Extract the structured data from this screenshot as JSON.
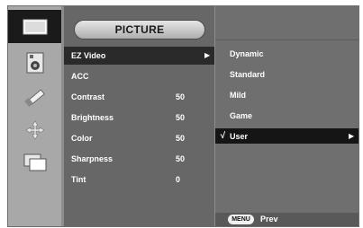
{
  "menu": {
    "title": "PICTURE",
    "items": [
      {
        "label": "EZ Video",
        "value": "",
        "arrow": "▶"
      },
      {
        "label": "ACC",
        "value": ""
      },
      {
        "label": "Contrast",
        "value": "50"
      },
      {
        "label": "Brightness",
        "value": "50"
      },
      {
        "label": "Color",
        "value": "50"
      },
      {
        "label": "Sharpness",
        "value": "50"
      },
      {
        "label": "Tint",
        "value": "0"
      }
    ]
  },
  "submenu": {
    "options": [
      {
        "label": "Dynamic"
      },
      {
        "label": "Standard"
      },
      {
        "label": "Mild"
      },
      {
        "label": "Game"
      },
      {
        "label": "User",
        "check": "√",
        "arrow": "▶"
      }
    ],
    "footer": {
      "button": "MENU",
      "label": "Prev"
    }
  },
  "icons": [
    "picture-icon",
    "audio-icon",
    "settings-icon",
    "position-icon",
    "pip-icon"
  ],
  "colors": {
    "frame": "#8d8d8d",
    "main_panel": "#676767",
    "sub_panel": "#6f6f6f",
    "selected_row": "#151515",
    "text": "#ffffff"
  }
}
